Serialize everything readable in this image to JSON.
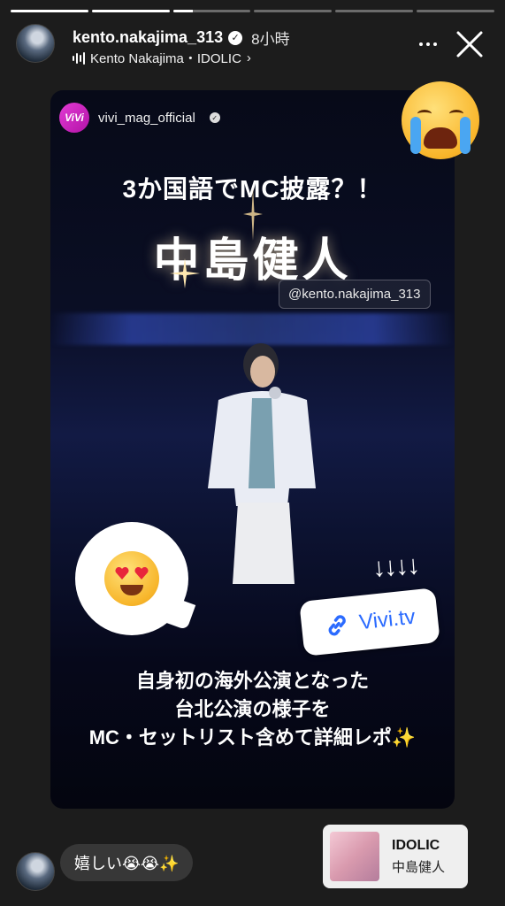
{
  "progress": [
    1,
    1,
    0.25,
    0,
    0,
    0
  ],
  "header": {
    "username": "kento.nakajima_313",
    "time": "8小時",
    "music": "Kento Nakajima・IDOLIC",
    "more_icon": "more-horizontal-icon",
    "close_icon": "close-icon"
  },
  "post": {
    "account": "vivi_mag_official",
    "logo_text": "ViVi",
    "headline": "3か国語でMC披露？！",
    "name": "中島健人",
    "handle_tag": "@kento.nakajima_313",
    "link": "Vivi.tv",
    "arrows": "↓↓↓↓",
    "desc": [
      "自身初の海外公演となった",
      "台北公演の様子を",
      "MC・セットリスト含めて詳細レポ✨"
    ]
  },
  "reply": {
    "text": "嬉しい😭😭✨"
  },
  "music_sticker": {
    "title": "IDOLIC",
    "artist": "中島健人"
  },
  "colors": {
    "background": "#1c1c1c",
    "vivi_brand": "#d62ad0",
    "link_blue": "#2b6bff"
  }
}
